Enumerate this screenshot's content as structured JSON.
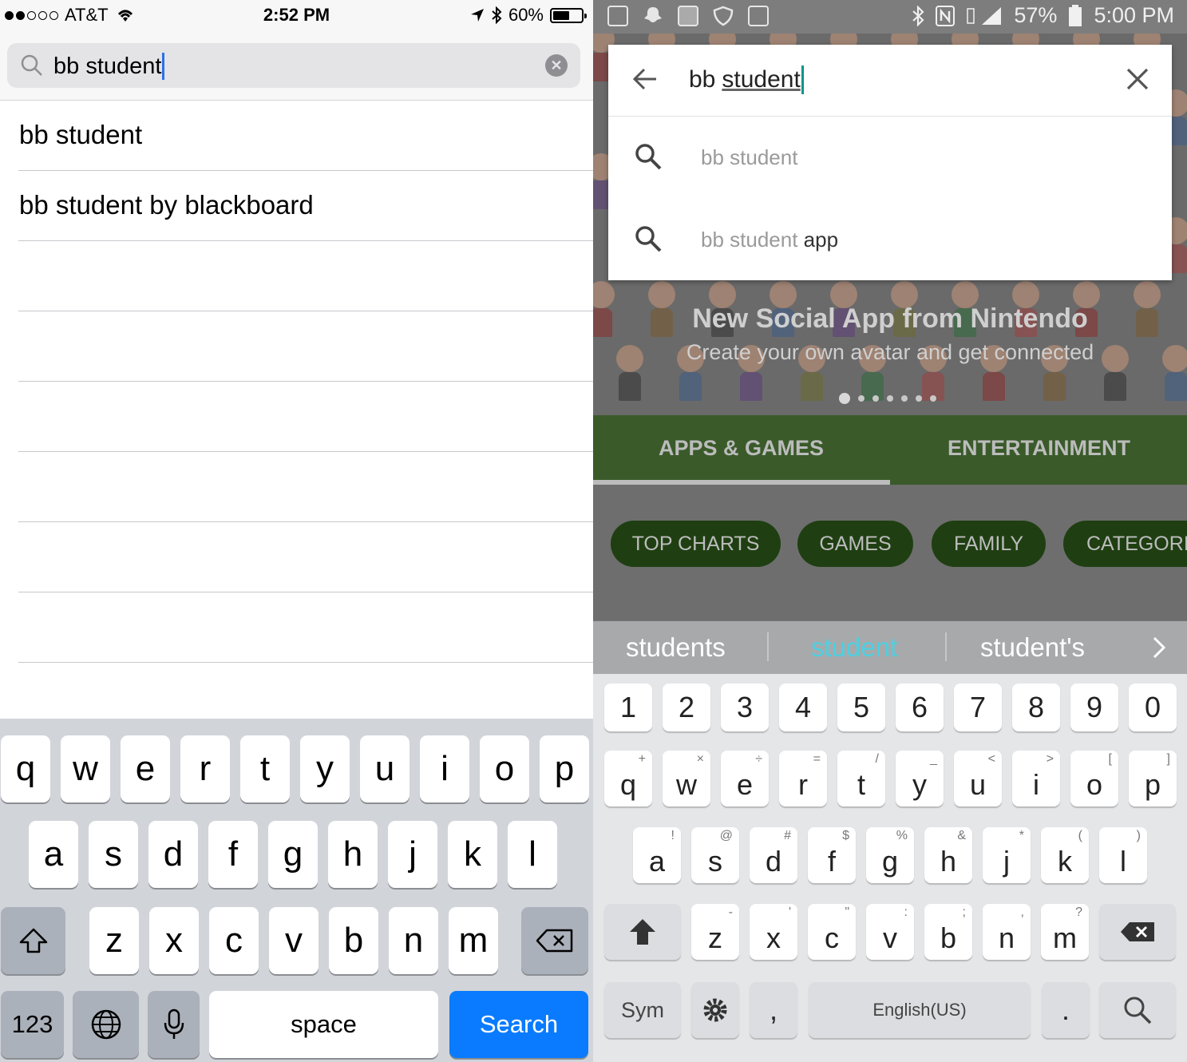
{
  "ios": {
    "status": {
      "carrier": "AT&T",
      "time": "2:52 PM",
      "battery": "60%"
    },
    "search": {
      "query": "bb student"
    },
    "results": [
      "bb student",
      "bb student by blackboard"
    ],
    "keyboard": {
      "row1": [
        "q",
        "w",
        "e",
        "r",
        "t",
        "y",
        "u",
        "i",
        "o",
        "p"
      ],
      "row2": [
        "a",
        "s",
        "d",
        "f",
        "g",
        "h",
        "j",
        "k",
        "l"
      ],
      "row3": [
        "z",
        "x",
        "c",
        "v",
        "b",
        "n",
        "m"
      ],
      "numbers_key": "123",
      "space_key": "space",
      "search_key": "Search"
    }
  },
  "android": {
    "status": {
      "battery": "57%",
      "time": "5:00 PM"
    },
    "search": {
      "query_prefix": "bb",
      "query_underlined": "student",
      "suggestions": [
        {
          "base": "bb student",
          "extra": ""
        },
        {
          "base": "bb student",
          "extra": "app"
        }
      ]
    },
    "banner": {
      "title": "New Social App from Nintendo",
      "subtitle": "Create your own avatar and get connected"
    },
    "tabs": [
      "APPS & GAMES",
      "ENTERTAINMENT"
    ],
    "chips": [
      "TOP CHARTS",
      "GAMES",
      "FAMILY",
      "CATEGORI"
    ],
    "keyboard": {
      "predictions": [
        "students",
        "student",
        "student's"
      ],
      "numbers": [
        "1",
        "2",
        "3",
        "4",
        "5",
        "6",
        "7",
        "8",
        "9",
        "0"
      ],
      "row1": [
        {
          "k": "q",
          "s": "+"
        },
        {
          "k": "w",
          "s": "×"
        },
        {
          "k": "e",
          "s": "÷"
        },
        {
          "k": "r",
          "s": "="
        },
        {
          "k": "t",
          "s": "/"
        },
        {
          "k": "y",
          "s": "_"
        },
        {
          "k": "u",
          "s": "<"
        },
        {
          "k": "i",
          "s": ">"
        },
        {
          "k": "o",
          "s": "["
        },
        {
          "k": "p",
          "s": "]"
        }
      ],
      "row2": [
        {
          "k": "a",
          "s": "!"
        },
        {
          "k": "s",
          "s": "@"
        },
        {
          "k": "d",
          "s": "#"
        },
        {
          "k": "f",
          "s": "$"
        },
        {
          "k": "g",
          "s": "%"
        },
        {
          "k": "h",
          "s": "&"
        },
        {
          "k": "j",
          "s": "*"
        },
        {
          "k": "k",
          "s": "("
        },
        {
          "k": "l",
          "s": ")"
        }
      ],
      "row3": [
        {
          "k": "z",
          "s": "-"
        },
        {
          "k": "x",
          "s": "'"
        },
        {
          "k": "c",
          "s": "\""
        },
        {
          "k": "v",
          "s": ":"
        },
        {
          "k": "b",
          "s": ";"
        },
        {
          "k": "n",
          "s": ","
        },
        {
          "k": "m",
          "s": "?"
        }
      ],
      "sym_key": "Sym",
      "comma_key": ",",
      "space_key": "English(US)",
      "period_key": "."
    }
  },
  "colors": {
    "ios_blue": "#0a7bff",
    "android_green_tab": "#3a5a2a",
    "android_chip": "#1f3f12",
    "prediction_highlight": "#4dd0e1"
  }
}
